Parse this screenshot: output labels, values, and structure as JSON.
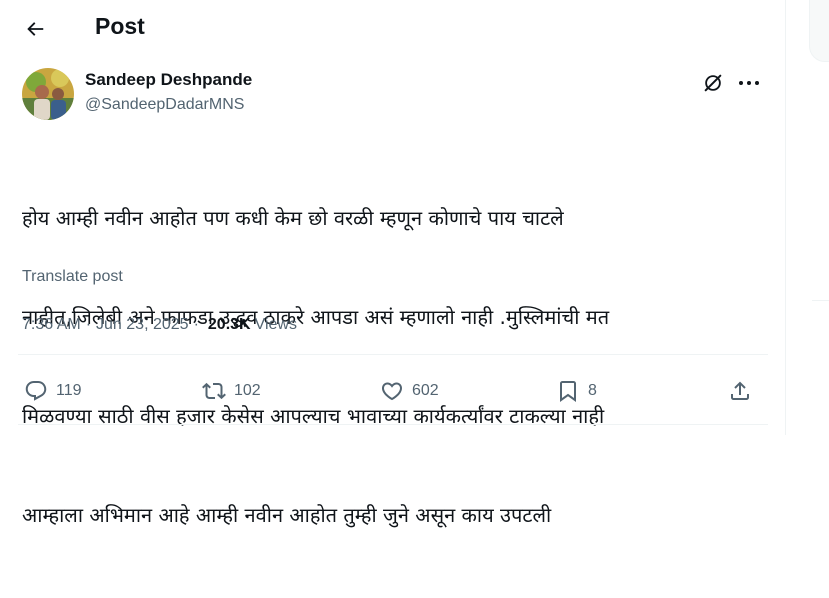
{
  "header": {
    "title": "Post"
  },
  "author": {
    "name": "Sandeep Deshpande",
    "handle": "@SandeepDadarMNS"
  },
  "post": {
    "lines": [
      "होय आम्ही नवीन आहोत पण कधी केम छो वरळी म्हणून कोणाचे पाय चाटले",
      "नाहीत,जिलेबी अने फाफडा उद्धव ठाकरे आपडा असं म्हणालो नाही .मुस्लिमांची मत",
      "मिळवण्या साठी वीस हजार केसेस आपल्याच भावाच्या कार्यकर्त्यांवर टाकल्या नाही",
      "आम्हाला अभिमान आहे आम्ही नवीन आहोत तुम्ही जुने असून काय उपटली"
    ],
    "translate_label": "Translate post",
    "time": "7:36 AM",
    "date": "Jun 23, 2025",
    "separator": "·",
    "views_count": "20.3K",
    "views_label": "Views"
  },
  "actions": {
    "replies": "119",
    "reposts": "102",
    "likes": "602",
    "bookmarks": "8"
  },
  "colors": {
    "text": "#0f1419",
    "muted": "#536471",
    "border": "#eff3f4"
  }
}
